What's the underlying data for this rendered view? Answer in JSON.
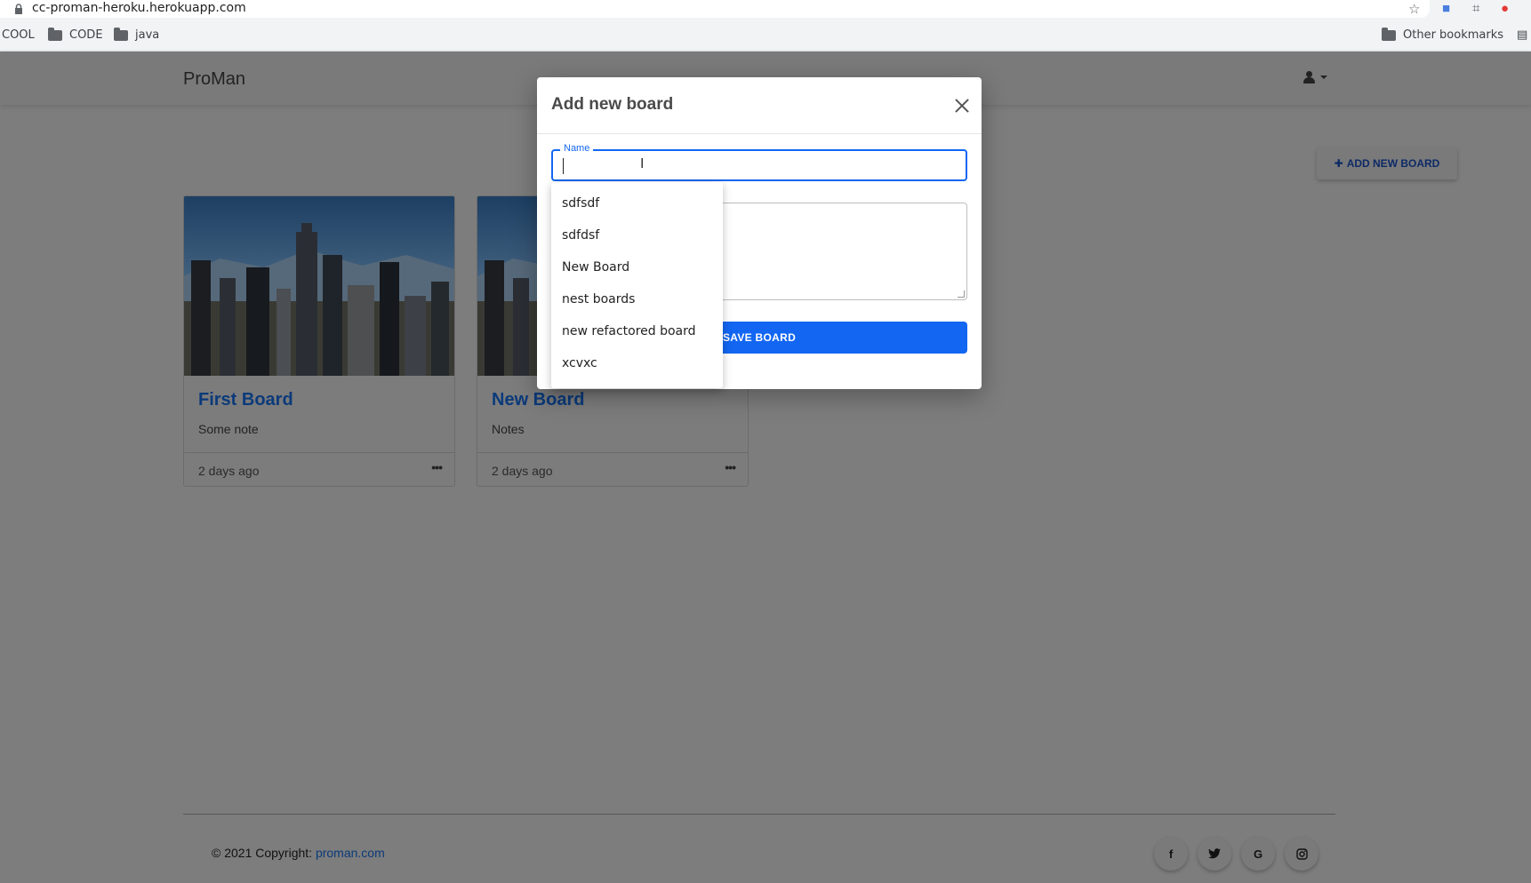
{
  "browser": {
    "url": "cc-proman-heroku.herokuapp.com",
    "bookmarks": [
      "COOL",
      "CODE",
      "java"
    ],
    "other_bookmarks": "Other bookmarks"
  },
  "navbar": {
    "brand": "ProMan"
  },
  "actions": {
    "add_board_label": "ADD NEW BOARD"
  },
  "boards": [
    {
      "title": "First Board",
      "note": "Some note",
      "time": "2 days ago"
    },
    {
      "title": "New Board",
      "note": "Notes",
      "time": "2 days ago"
    }
  ],
  "footer": {
    "copyright": "© 2021 Copyright: ",
    "link": "proman.com",
    "social": [
      "f",
      "t",
      "G",
      "ig"
    ]
  },
  "modal": {
    "title": "Add new board",
    "name_label": "Name",
    "name_value": "",
    "save_label": "SAVE BOARD"
  },
  "autocomplete": {
    "items": [
      "sdfsdf",
      "sdfdsf",
      "New Board",
      "nest boards",
      "new refactored board",
      "xcvxc"
    ]
  },
  "colors": {
    "accent": "#1266f1",
    "backdrop": "#7d7d7d",
    "link": "#0b3a7a"
  }
}
